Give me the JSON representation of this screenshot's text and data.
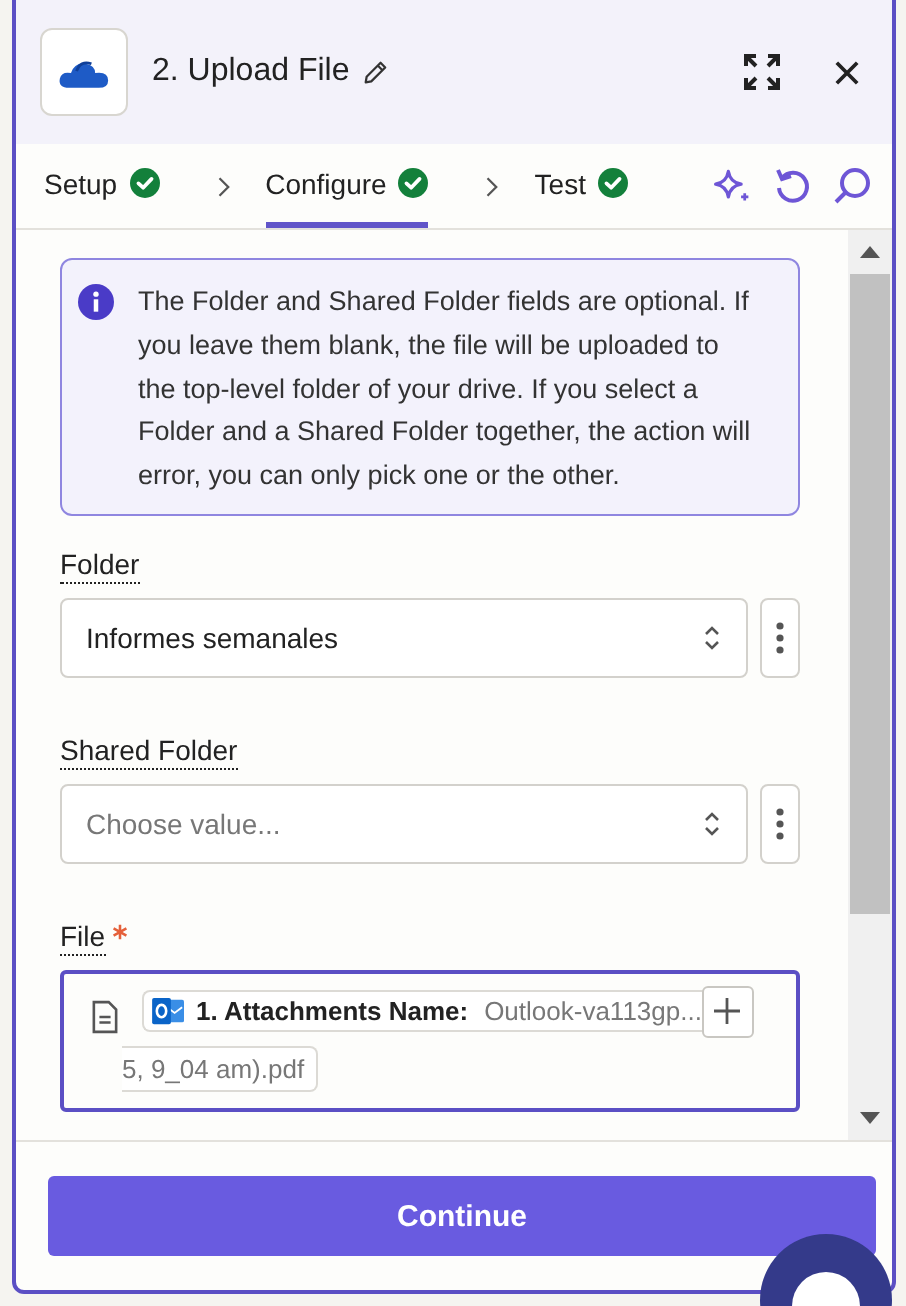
{
  "header": {
    "title": "2. Upload File"
  },
  "steps": [
    {
      "label": "Setup",
      "done": true,
      "selected": false
    },
    {
      "label": "Configure",
      "done": true,
      "selected": true
    },
    {
      "label": "Test",
      "done": true,
      "selected": false
    }
  ],
  "info": {
    "text": "The Folder and Shared Folder fields are optional. If you leave them blank, the file will be uploaded to the top-level folder of your drive. If you select a Folder and a Shared Folder together, the action will error, you can only pick one or the other."
  },
  "fields": [
    {
      "kind": "select",
      "label": "Folder",
      "required": false,
      "focused": false,
      "value": "Informes semanales"
    },
    {
      "kind": "select",
      "label": "Shared Folder",
      "required": false,
      "focused": false,
      "placeholder": "Choose value..."
    },
    {
      "kind": "mapped",
      "label": "File",
      "required": true,
      "focused": true,
      "pill": {
        "label": "1. Attachments Name:",
        "value": "Outlook-va113gp...",
        "continuation": "5, 9_04 am).pdf"
      }
    }
  ],
  "continue_button": "Continue"
}
